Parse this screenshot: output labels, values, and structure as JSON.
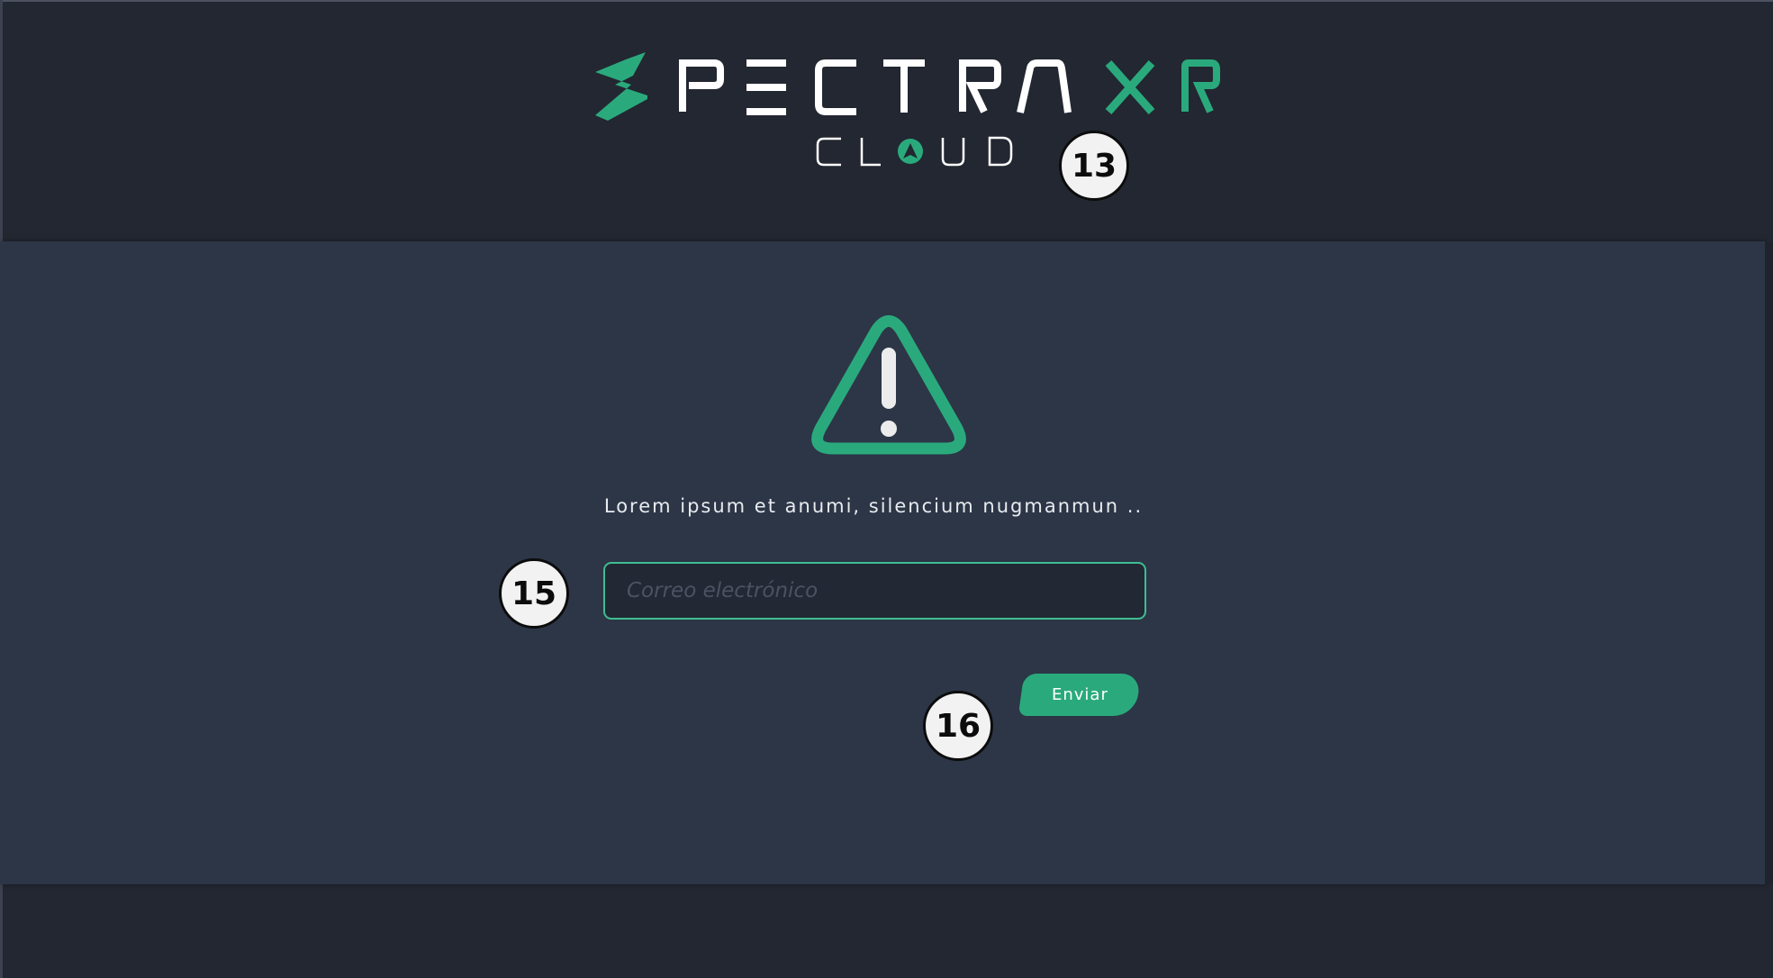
{
  "brand": {
    "name": "SPECTRA XR",
    "subtitle": "CLOUD",
    "colors": {
      "accent": "#2aaa7c",
      "logo_text": "#ffffff"
    }
  },
  "alert": {
    "icon": "warning-triangle-icon",
    "message": "Lorem ipsum et anumi, silencium nugmanmun .."
  },
  "form": {
    "email": {
      "value": "",
      "placeholder": "Correo electrónico"
    },
    "submit_label": "Enviar"
  },
  "markers": [
    "13",
    "15",
    "16"
  ],
  "colors": {
    "background": "#222731",
    "panel": "#2c3647",
    "accent": "#2aaa7c",
    "input_border": "#3fbd8f"
  }
}
